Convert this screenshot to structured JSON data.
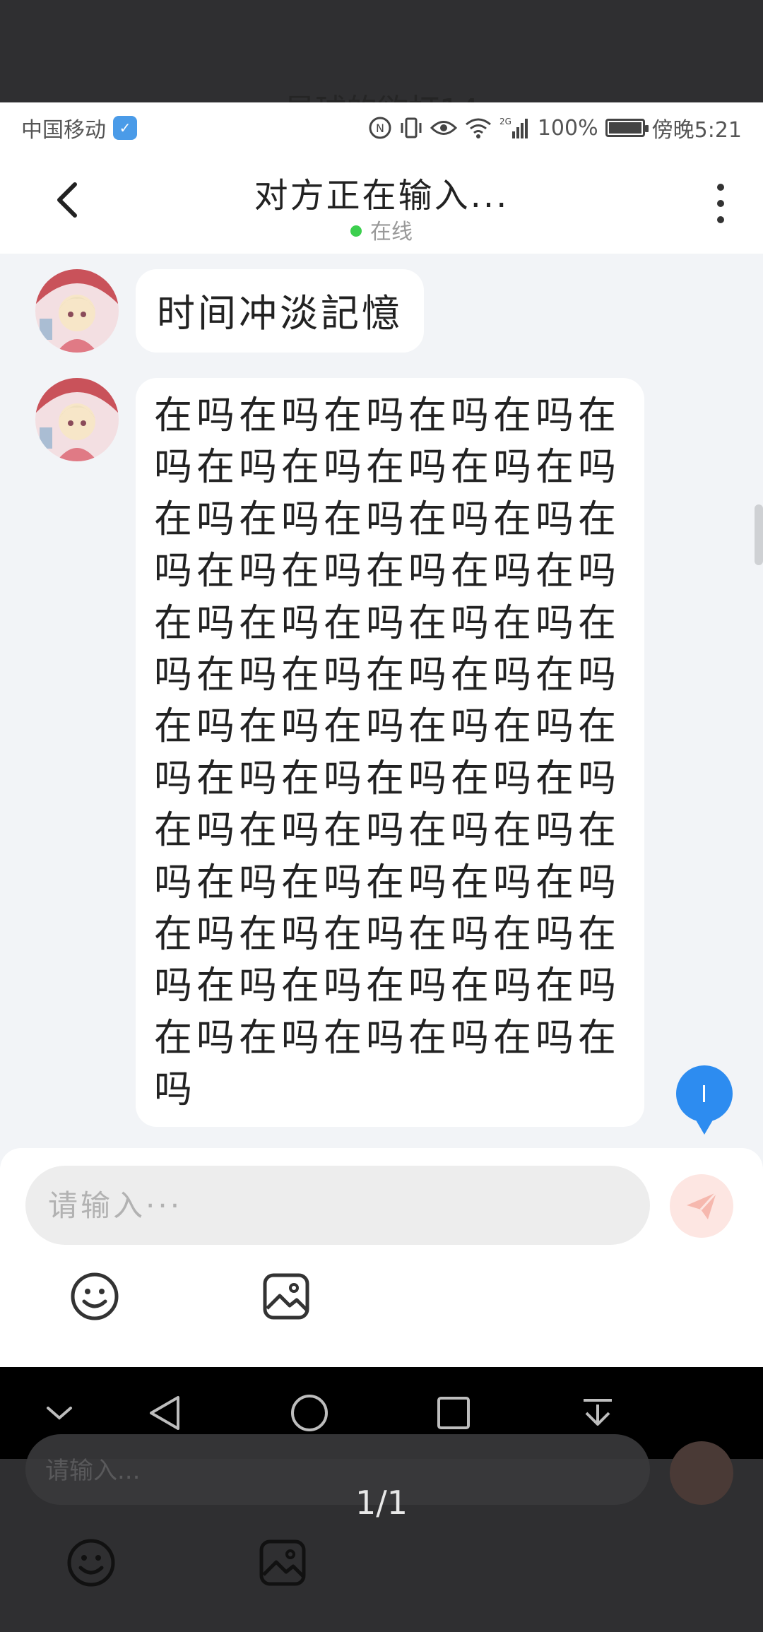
{
  "background": {
    "ghost_title": "星球的欲打14"
  },
  "status_bar": {
    "carrier": "中国移动",
    "network": "2G",
    "battery": "100%",
    "time": "傍晚5:21"
  },
  "header": {
    "title": "对方正在输入...",
    "status": "在线"
  },
  "messages": [
    {
      "text": "时间冲淡記憶"
    },
    {
      "text": "在吗在吗在吗在吗在吗在吗在吗在吗在吗在吗在吗在吗在吗在吗在吗在吗在吗在吗在吗在吗在吗在吗在吗在吗在吗在吗在吗在吗在吗在吗在吗在吗在吗在吗在吗在吗在吗在吗在吗在吗在吗在吗在吗在吗在吗在吗在吗在吗在吗在吗在吗在吗在吗在吗在吗在吗在吗在吗在吗在吗在吗在吗在吗在吗在吗在吗在吗在吗在吗在吗在吗在吗"
    }
  ],
  "composer": {
    "placeholder": "请输入···",
    "value": ""
  },
  "page_indicator": "1/1",
  "ghost_composer": {
    "placeholder": "请输入..."
  },
  "colors": {
    "accent": "#2d8cf0",
    "online": "#3ccf4e",
    "send_bg": "#fde6e2",
    "send_icon": "#f6b8ae"
  }
}
